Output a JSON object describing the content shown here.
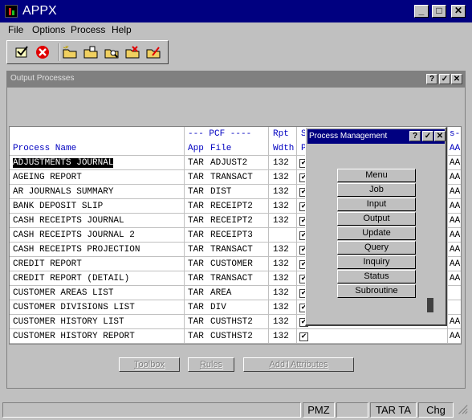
{
  "app": {
    "title": "APPX"
  },
  "menu": [
    "File",
    "Options",
    "Process",
    "Help"
  ],
  "toolbar": {
    "icons": [
      "ok-check-icon",
      "cancel-icon",
      "new-folder-icon",
      "open-folder-icon",
      "search-folder-icon",
      "delete-folder-icon",
      "edit-folder-icon"
    ]
  },
  "output_window": {
    "title": "Output Processes",
    "controls": [
      "?",
      "✓",
      "✕"
    ],
    "headers": {
      "name": "Process Name",
      "pcf_top": "--- PCF ----",
      "app": "App",
      "file": "File",
      "rpt_top": "Rpt",
      "wdth": "Wdth",
      "s_top": "S",
      "p": "P",
      "last_top": "s-",
      "last": "AA"
    },
    "rows": [
      {
        "name": "ADJUSTMENTS JOURNAL",
        "app": "TAR",
        "file": "ADJUST2",
        "wdth": "132",
        "checked": true,
        "last": "AA",
        "selected": true
      },
      {
        "name": "AGEING REPORT",
        "app": "TAR",
        "file": "TRANSACT",
        "wdth": "132",
        "checked": true,
        "last": "AA",
        "selected": false
      },
      {
        "name": "AR JOURNALS SUMMARY",
        "app": "TAR",
        "file": "DIST",
        "wdth": "132",
        "checked": true,
        "last": "AA",
        "selected": false
      },
      {
        "name": "BANK DEPOSIT SLIP",
        "app": "TAR",
        "file": "RECEIPT2",
        "wdth": "132",
        "checked": true,
        "last": "AA",
        "selected": false
      },
      {
        "name": "CASH RECEIPTS JOURNAL",
        "app": "TAR",
        "file": "RECEIPT2",
        "wdth": "132",
        "checked": true,
        "last": "AA",
        "selected": false
      },
      {
        "name": "CASH RECEIPTS JOURNAL 2",
        "app": "TAR",
        "file": "RECEIPT3",
        "wdth": "",
        "checked": true,
        "last": "AA",
        "selected": false
      },
      {
        "name": "CASH RECEIPTS PROJECTION",
        "app": "TAR",
        "file": "TRANSACT",
        "wdth": "132",
        "checked": true,
        "last": "AA",
        "selected": false
      },
      {
        "name": "CREDIT REPORT",
        "app": "TAR",
        "file": "CUSTOMER",
        "wdth": "132",
        "checked": true,
        "last": "AA",
        "selected": false
      },
      {
        "name": "CREDIT REPORT (DETAIL)",
        "app": "TAR",
        "file": "TRANSACT",
        "wdth": "132",
        "checked": true,
        "last": "AA",
        "selected": false
      },
      {
        "name": "CUSTOMER AREAS LIST",
        "app": "TAR",
        "file": "AREA",
        "wdth": "132",
        "checked": true,
        "last": "",
        "selected": false
      },
      {
        "name": "CUSTOMER DIVISIONS LIST",
        "app": "TAR",
        "file": "DIV",
        "wdth": "132",
        "checked": true,
        "last": "",
        "selected": false
      },
      {
        "name": "CUSTOMER HISTORY LIST",
        "app": "TAR",
        "file": "CUSTHST2",
        "wdth": "132",
        "checked": true,
        "last": "AA",
        "selected": false
      },
      {
        "name": "CUSTOMER HISTORY REPORT",
        "app": "TAR",
        "file": "CUSTHST2",
        "wdth": "132",
        "checked": true,
        "last": "AA",
        "selected": false
      }
    ],
    "buttons": {
      "toolbox": "Toolbox",
      "rules": "Rules",
      "attributes": "Add'l Attributes"
    }
  },
  "process_management": {
    "title": "Process Management",
    "controls": [
      "?",
      "✓",
      "✕"
    ],
    "buttons": [
      "Menu",
      "Job",
      "Input",
      "Output",
      "Update",
      "Query",
      "Inquiry",
      "Status",
      "Subroutine"
    ]
  },
  "statusbar": {
    "seg1": "",
    "pmz": "PMZ",
    "seg3": "",
    "tarta": "TAR TA",
    "chg": "Chg"
  }
}
